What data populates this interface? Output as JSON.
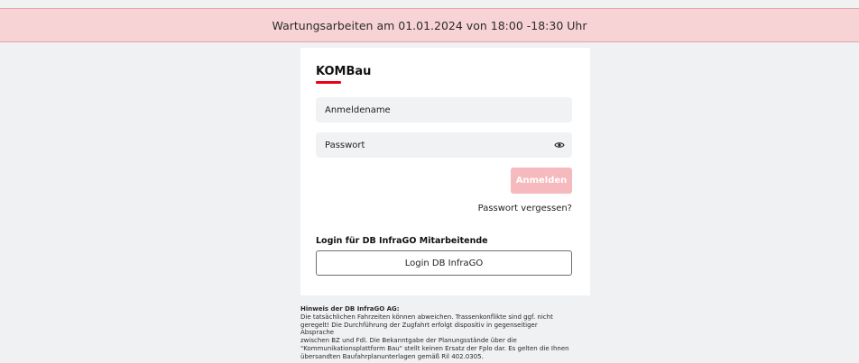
{
  "banner": {
    "text": "Wartungsarbeiten am 01.01.2024 von 18:00 -18:30 Uhr"
  },
  "login": {
    "brand": "KOMBau",
    "username_placeholder": "Anmeldename",
    "password_placeholder": "Passwort",
    "password_toggle_icon": "eye-icon",
    "submit_label": "Anmelden",
    "forgot_label": "Passwort vergessen?",
    "sso_title": "Login für DB InfraGO Mitarbeitende",
    "sso_button_label": "Login DB InfraGO"
  },
  "notice": {
    "title": "Hinweis der DB InfraGO AG:",
    "lines": [
      "Die tatsächlichen Fahrzeiten können abweichen. Trassenkonflikte sind ggf. nicht",
      "geregelt! Die Durchführung der Zugfahrt erfolgt dispositiv in gegenseitiger Absprache",
      "zwischen BZ und Fdl. Die Bekanntgabe der Planungsstände über die",
      "\"Kommunikationsplattform Bau\" stellt keinen Ersatz der Fplo dar. Es gelten die Ihnen",
      "übersandten Baufahrplanunterlagen gemäß Ril 402.0305."
    ]
  },
  "colors": {
    "accent": "#ec0016",
    "banner_bg": "#f8d3d5",
    "disabled_button": "#f6b9bd",
    "page_bg": "#f0f1f3"
  }
}
